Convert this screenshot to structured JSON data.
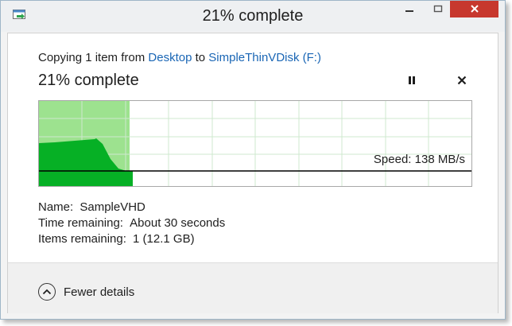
{
  "window": {
    "title": "21% complete",
    "icons": {
      "app": "copy-icon",
      "minimize": "minimize-icon",
      "maximize": "maximize-icon",
      "close": "close-icon"
    },
    "colors": {
      "close_bg": "#c7382e",
      "link": "#1a66b5",
      "graph_fill": "#06b025",
      "graph_progress": "#9de28f"
    }
  },
  "copy_line": {
    "prefix": "Copying 1 item from ",
    "source": "Desktop",
    "connector": " to ",
    "destination": "SimpleThinVDisk (F:)"
  },
  "progress": {
    "heading": "21% complete",
    "percent": 21,
    "pause_icon": "pause-icon",
    "cancel_icon": "cancel-icon"
  },
  "graph": {
    "speed_label": "Speed: 138 MB/s"
  },
  "details": {
    "name_label": "Name:",
    "name_value": "SampleVHD",
    "time_label": "Time remaining:",
    "time_value": "About 30 seconds",
    "items_label": "Items remaining:",
    "items_value": "1 (12.1 GB)"
  },
  "footer": {
    "toggle_label": "Fewer details",
    "toggle_icon": "chevron-up-icon"
  }
}
